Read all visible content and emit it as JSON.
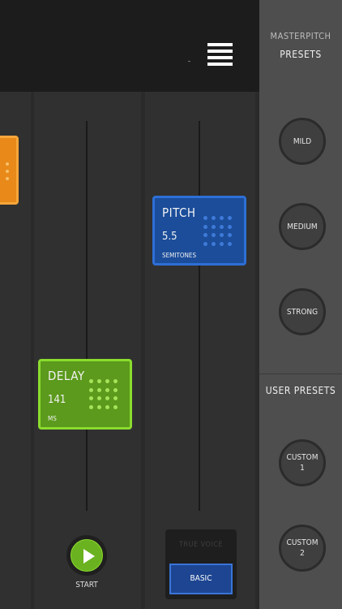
{
  "presets_panel": {
    "master_title_line1": "MASTERPITCH",
    "master_title_line2": "PRESETS",
    "master_presets": [
      "MILD",
      "MEDIUM",
      "STRONG"
    ],
    "user_title": "USER PRESETS",
    "user_presets": [
      {
        "line1": "CUSTOM",
        "line2": "1"
      },
      {
        "line1": "CUSTOM",
        "line2": "2"
      }
    ]
  },
  "tiles": {
    "pitch": {
      "title": "PITCH",
      "value": "5.5",
      "unit": "SEMITONES",
      "color": "#1b4d9a"
    },
    "delay": {
      "title": "DELAY",
      "value": "141",
      "unit": "MS",
      "color": "#5b9a1c"
    },
    "orange": {
      "color": "#e8891a"
    }
  },
  "controls": {
    "start_label": "START",
    "true_voice_label": "TRUE VOICE",
    "basic_label": "BASIC"
  },
  "icons": {
    "menu": "hamburger-menu-icon",
    "play": "play-icon"
  }
}
